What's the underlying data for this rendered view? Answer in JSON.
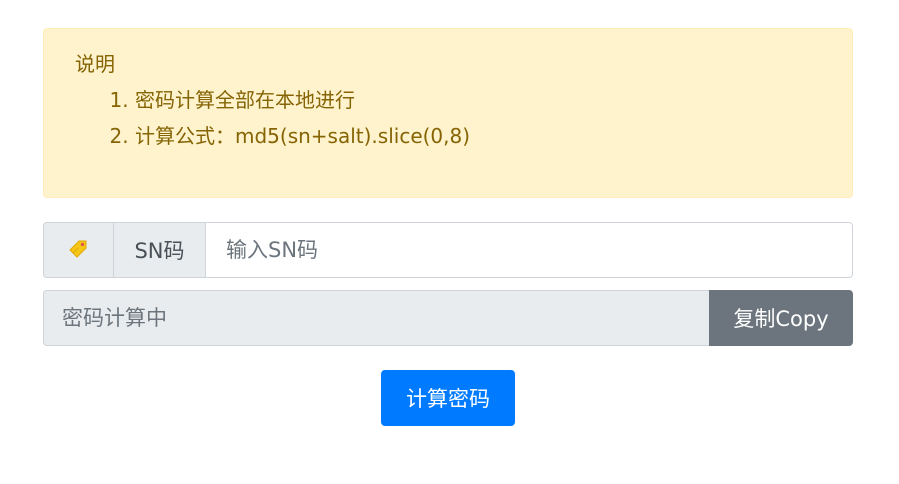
{
  "notice": {
    "title": "说明",
    "items": [
      "密码计算全部在本地进行",
      "计算公式：md5(sn+salt).slice(0,8)"
    ]
  },
  "sn": {
    "icon": "tag-icon",
    "label": "SN码",
    "placeholder": "输入SN码",
    "value": ""
  },
  "password": {
    "placeholder": "密码计算中",
    "value": "",
    "copy_label": "复制Copy"
  },
  "calculate_label": "计算密码",
  "colors": {
    "alert_bg": "#fff3cd",
    "alert_text": "#856404",
    "addon_bg": "#e9ecef",
    "copy_button": "#6c757d",
    "primary_button": "#007bff",
    "tag_icon": "#f5c518"
  }
}
